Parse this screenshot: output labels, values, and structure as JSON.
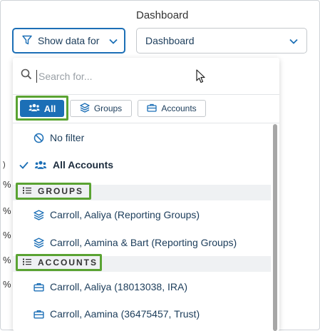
{
  "header": {
    "title": "Dashboard",
    "show_data_label": "Show data for",
    "dashboard_select_value": "Dashboard"
  },
  "side_marks": [
    ")",
    "%",
    "%",
    "%",
    "%",
    "%"
  ],
  "search": {
    "placeholder": "Search for..."
  },
  "tabs": {
    "all": "All",
    "groups": "Groups",
    "accounts": "Accounts"
  },
  "list": {
    "no_filter": "No filter",
    "all_accounts": "All Accounts",
    "groups_header": "GROUPS",
    "groups": [
      "Carroll, Aaliya (Reporting Groups)",
      "Carroll, Aamina & Bart (Reporting Groups)"
    ],
    "accounts_header": "ACCOUNTS",
    "accounts": [
      "Carroll, Aaliya (18013038, IRA)",
      "Carroll, Aamina (36475457, Trust)"
    ]
  },
  "colors": {
    "accent_blue": "#1c6fb6",
    "highlight_green": "#5aa332",
    "text_dark": "#1b3c5a"
  }
}
